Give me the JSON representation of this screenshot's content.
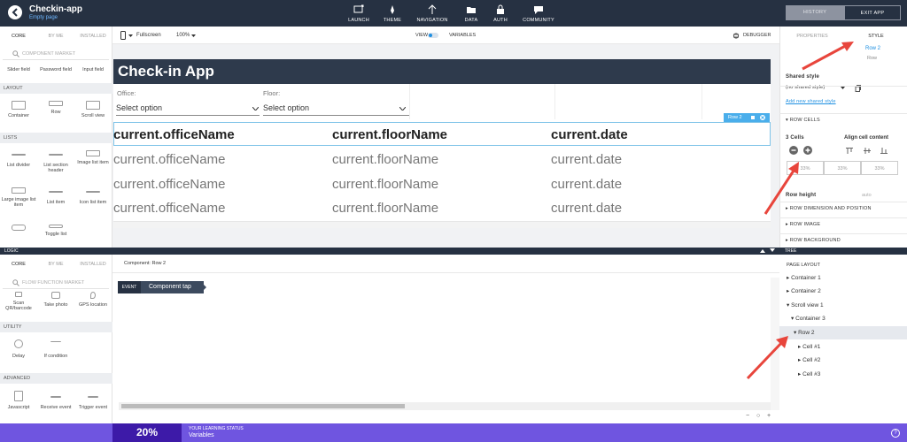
{
  "app": {
    "name": "Checkin-app",
    "page": "Empty page"
  },
  "topnav": [
    {
      "label": "LAUNCH",
      "icon": "launch-icon"
    },
    {
      "label": "THEME",
      "icon": "theme-icon"
    },
    {
      "label": "NAVIGATION",
      "icon": "navigation-icon"
    },
    {
      "label": "DATA",
      "icon": "data-icon"
    },
    {
      "label": "AUTH",
      "icon": "auth-icon"
    },
    {
      "label": "COMMUNITY",
      "icon": "community-icon"
    }
  ],
  "topbuttons": {
    "history": "HISTORY",
    "exit": "EXIT APP"
  },
  "leftpanel": {
    "tabs": [
      "CORE",
      "BY ME",
      "INSTALLED"
    ],
    "search_placeholder": "COMPONENT MARKET",
    "row0": [
      "Slider field",
      "Password field",
      "Input field"
    ],
    "layout_title": "LAYOUT",
    "layout": [
      "Container",
      "Row",
      "Scroll view"
    ],
    "lists_title": "LISTS",
    "lists1": [
      "List divider",
      "List section header",
      "Image list item"
    ],
    "lists2": [
      "Large image list item",
      "List item",
      "Icon list item"
    ],
    "lists3": [
      "Toggle list"
    ]
  },
  "canvas": {
    "device": "Fullscreen",
    "zoom": "100%",
    "view_label": "VIEW",
    "variables_label": "VARIABLES",
    "debugger": "DEBUGGER",
    "app_title": "Check-in App",
    "office_label": "Office:",
    "floor_label": "Floor:",
    "office_select": "Select option",
    "floor_select": "Select option",
    "row_tag": "Row 2",
    "header_row": [
      "current.officeName",
      "current.floorName",
      "current.date"
    ],
    "rows": [
      [
        "current.officeName",
        "current.floorName",
        "current.date"
      ],
      [
        "current.officeName",
        "current.floorName",
        "current.date"
      ],
      [
        "current.officeName",
        "current.floorName",
        "current.date"
      ]
    ]
  },
  "rightpanel": {
    "tabs": [
      "PROPERTIES",
      "STYLE"
    ],
    "selected_name": "Row 2",
    "selected_type": "Row",
    "shared_style_title": "Shared style",
    "shared_style_value": "(no shared style)",
    "add_shared": "Add new shared style",
    "row_cells": "ROW CELLS",
    "cells_count": "3 Cells",
    "align_title": "Align cell content",
    "cell_widths": [
      "33%",
      "33%",
      "33%"
    ],
    "row_height_label": "Row height",
    "row_height_value": "auto",
    "sections": [
      "ROW DIMENSION AND POSITION",
      "ROW IMAGE",
      "ROW BACKGROUND"
    ]
  },
  "logic": {
    "bar_label": "LOGIC",
    "tabs": [
      "CORE",
      "BY ME",
      "INSTALLED"
    ],
    "search_placeholder": "FLOW FUNCTION MARKET",
    "row0": [
      "Scan QR/barcode",
      "Take photo",
      "GPS location"
    ],
    "utility_title": "UTILITY",
    "utility": [
      "Delay",
      "If condition"
    ],
    "advanced_title": "ADVANCED",
    "advanced": [
      "Javascript",
      "Receive event",
      "Trigger event"
    ],
    "component_label": "Component: Row 2",
    "event_tag": "EVENT",
    "event_name": "Component tap"
  },
  "tree": {
    "bar_label": "TREE",
    "title": "PAGE LAYOUT",
    "items": [
      "Container 1",
      "Container 2",
      "Scroll view 1",
      "Container 3",
      "Row 2",
      "Cell #1",
      "Cell #2",
      "Cell #3"
    ]
  },
  "learning": {
    "percent": "20%",
    "caption": "YOUR LEARNING STATUS",
    "topic": "Variables"
  }
}
